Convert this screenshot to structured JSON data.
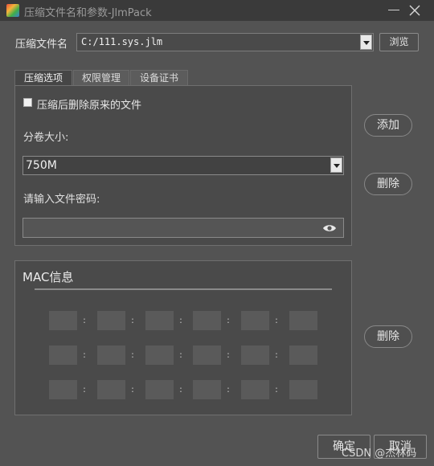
{
  "window": {
    "title": "压缩文件名和参数-JlmPack"
  },
  "file": {
    "label": "压缩文件名",
    "value": "C:/111.sys.jlm",
    "browse_label": "浏览"
  },
  "tabs": [
    {
      "label": "压缩选项"
    },
    {
      "label": "权限管理"
    },
    {
      "label": "设备证书"
    }
  ],
  "options": {
    "delete_after_label": "压缩后删除原来的文件",
    "delete_after_checked": false,
    "split_label": "分卷大小:",
    "split_value": "750M",
    "password_label": "请输入文件密码:",
    "password_value": ""
  },
  "side_buttons": {
    "add": "添加",
    "delete_top": "删除",
    "delete_mac": "删除"
  },
  "mac": {
    "title": "MAC信息",
    "separator": ":",
    "rows": [
      [
        "",
        "",
        "",
        "",
        "",
        ""
      ],
      [
        "",
        "",
        "",
        "",
        "",
        ""
      ],
      [
        "",
        "",
        "",
        "",
        "",
        ""
      ]
    ]
  },
  "footer": {
    "ok": "确定",
    "cancel": "取消",
    "watermark": "CSDN @杰林码"
  },
  "icons": {
    "app": "jlmpack-app-icon",
    "minimize": "minimize-icon",
    "close": "close-icon",
    "dropdown": "chevron-down-icon",
    "password_visibility": "eye-icon"
  }
}
